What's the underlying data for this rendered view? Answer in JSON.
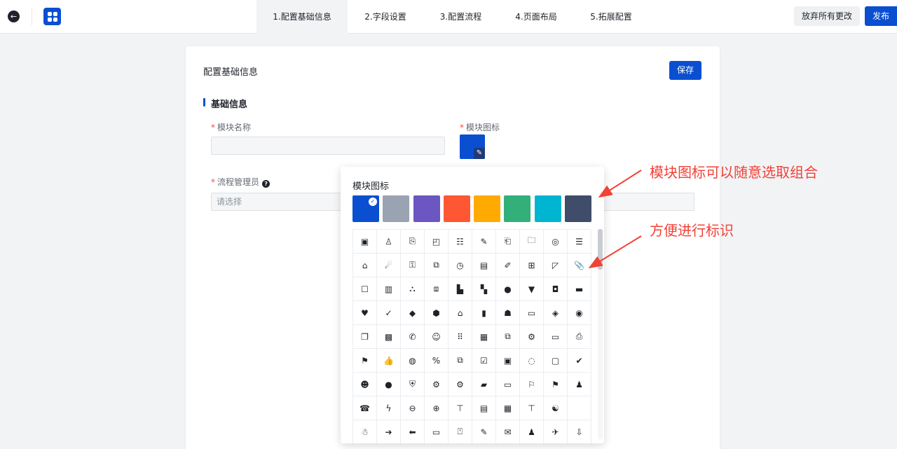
{
  "topbar": {
    "back_icon": "arrow-left-circle-icon",
    "logo_icon": "app-grid-icon",
    "steps": [
      {
        "label": "1.配置基础信息",
        "active": true
      },
      {
        "label": "2.字段设置",
        "active": false
      },
      {
        "label": "3.配置流程",
        "active": false
      },
      {
        "label": "4.页面布局",
        "active": false
      },
      {
        "label": "5.拓展配置",
        "active": false
      }
    ],
    "discard_label": "放弃所有更改",
    "publish_label": "发布"
  },
  "card": {
    "title": "配置基础信息",
    "save_label": "保存",
    "section_title": "基础信息",
    "module_name": {
      "label": "模块名称",
      "required": "*",
      "value": ""
    },
    "module_icon": {
      "label": "模块图标",
      "required": "*",
      "color": "#0b4fd1",
      "edit_icon": "pencil-icon"
    },
    "process_admin": {
      "label": "流程管理员",
      "required": "*",
      "placeholder": "请选择",
      "help_icon": "question-circle-icon"
    }
  },
  "icon_picker": {
    "title": "模块图标",
    "colors": [
      "#0b4fd1",
      "#99a3b1",
      "#6b56c2",
      "#ff5733",
      "#ffaa00",
      "#33b07a",
      "#00b5d1",
      "#3f4d6b"
    ],
    "selected_color_index": 0,
    "icons": [
      "▣",
      "♙",
      "⎘",
      "◰",
      "☷",
      "✎",
      "⎗",
      "🗀",
      "◎",
      "☰",
      "⌂",
      "☄",
      "⚿",
      "⧉",
      "◷",
      "▤",
      "✐",
      "⊞",
      "◸",
      "📎",
      "☐",
      "▥",
      "⛬",
      "⧈",
      "▙",
      "▚",
      "●",
      "▼",
      "◘",
      "▬",
      "♥",
      "✓",
      "◆",
      "⬢",
      "⌂",
      "▮",
      "☗",
      "▭",
      "◈",
      "◉",
      "❐",
      "▩",
      "✆",
      "☺",
      "⠿",
      "▦",
      "⧉",
      "⚙",
      "▭",
      "⎙",
      "⚑",
      "👍",
      "◍",
      "%",
      "⧉",
      "☑",
      "▣",
      "◌",
      "▢",
      "✔",
      "☻",
      "●",
      "⛨",
      "⚙",
      "⚙",
      "▰",
      "▭",
      "⚐",
      "⚑",
      "♟",
      "☎",
      "ϟ",
      "⊖",
      "⊕",
      "⊤",
      "▤",
      "▦",
      "⊤",
      "☯",
      "",
      "☃",
      "➔",
      "⬅",
      "▭",
      "⍞",
      "✎",
      "✉",
      "♟",
      "✈",
      "⇩"
    ]
  },
  "annotations": {
    "note1": "模块图标可以随意选取组合",
    "note2": "方便进行标识"
  }
}
